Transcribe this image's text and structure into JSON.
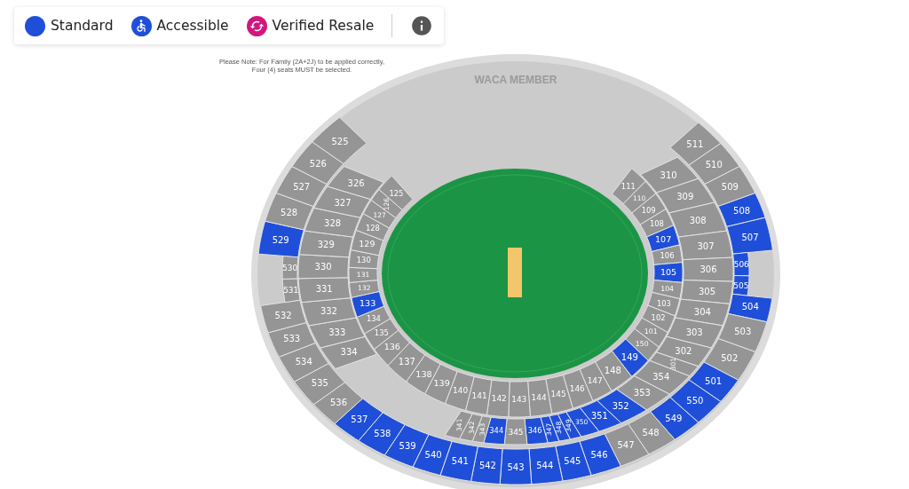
{
  "legend": {
    "items": [
      {
        "kind": "standard",
        "label": "Standard",
        "color": "#1f4fd8"
      },
      {
        "kind": "accessible",
        "label": "Accessible",
        "color": "#1f4fd8"
      },
      {
        "kind": "resale",
        "label": "Verified Resale",
        "color": "#d1167e"
      }
    ]
  },
  "notice": {
    "lines": [
      "Please Note: For Family (2A+2J) to be applied correctly,",
      "Four (4) seats MUST be selected."
    ]
  },
  "map": {
    "area_label": "WACA MEMBER",
    "tiers": [
      {
        "left": [
          {
            "label": "125",
            "available": false
          },
          {
            "label": "126",
            "available": false
          },
          {
            "label": "127",
            "available": false
          },
          {
            "label": "128",
            "available": false
          },
          {
            "label": "129",
            "available": false
          },
          {
            "label": "130",
            "available": false
          },
          {
            "label": "131",
            "available": false
          },
          {
            "label": "132",
            "available": false
          },
          {
            "label": "133",
            "available": true
          },
          {
            "label": "134",
            "available": false
          },
          {
            "label": "135",
            "available": false
          },
          {
            "label": "136",
            "available": false
          }
        ],
        "bottom": [
          {
            "label": "137",
            "available": false
          },
          {
            "label": "138",
            "available": false
          },
          {
            "label": "139",
            "available": false
          },
          {
            "label": "140",
            "available": false
          },
          {
            "label": "141",
            "available": false
          },
          {
            "label": "142",
            "available": false
          },
          {
            "label": "143",
            "available": false
          },
          {
            "label": "144",
            "available": false
          },
          {
            "label": "145",
            "available": false
          },
          {
            "label": "146",
            "available": false
          },
          {
            "label": "147",
            "available": false
          },
          {
            "label": "148",
            "available": false
          }
        ],
        "right": [
          {
            "label": "111",
            "available": false
          },
          {
            "label": "110",
            "available": false
          },
          {
            "label": "109",
            "available": false
          },
          {
            "label": "108",
            "available": false
          },
          {
            "label": "107",
            "available": true
          },
          {
            "label": "106",
            "available": false
          },
          {
            "label": "105",
            "available": true
          },
          {
            "label": "104",
            "available": false
          },
          {
            "label": "103",
            "available": false
          },
          {
            "label": "102",
            "available": false
          },
          {
            "label": "101",
            "available": false
          },
          {
            "label": "150",
            "available": false
          },
          {
            "label": "149",
            "available": true
          }
        ]
      },
      {
        "left": [
          {
            "label": "326",
            "available": false
          },
          {
            "label": "327",
            "available": false
          },
          {
            "label": "328",
            "available": false
          },
          {
            "label": "329",
            "available": false
          },
          {
            "label": "330",
            "available": false
          },
          {
            "label": "331",
            "available": false
          },
          {
            "label": "332",
            "available": false
          },
          {
            "label": "333",
            "available": false
          },
          {
            "label": "334",
            "available": false
          }
        ],
        "bottom": [
          {
            "label": "341",
            "available": false
          },
          {
            "label": "342",
            "available": false
          },
          {
            "label": "343",
            "available": false
          },
          {
            "label": "344",
            "available": true
          },
          {
            "label": "345",
            "available": false
          },
          {
            "label": "346",
            "available": true
          },
          {
            "label": "347",
            "available": true
          },
          {
            "label": "348",
            "available": true
          },
          {
            "label": "349",
            "available": true
          },
          {
            "label": "350",
            "available": true
          },
          {
            "label": "351",
            "available": true
          },
          {
            "label": "352",
            "available": true
          }
        ],
        "right": [
          {
            "label": "310",
            "available": false
          },
          {
            "label": "309",
            "available": false
          },
          {
            "label": "308",
            "available": false
          },
          {
            "label": "307",
            "available": false
          },
          {
            "label": "306",
            "available": false
          },
          {
            "label": "305",
            "available": false
          },
          {
            "label": "304",
            "available": false
          },
          {
            "label": "303",
            "available": false
          },
          {
            "label": "302",
            "available": false
          },
          {
            "label": "301",
            "available": false
          },
          {
            "label": "354",
            "available": false
          },
          {
            "label": "353",
            "available": false
          }
        ]
      },
      {
        "left": [
          {
            "label": "525",
            "available": false
          },
          {
            "label": "526",
            "available": false
          },
          {
            "label": "527",
            "available": false
          },
          {
            "label": "528",
            "available": false
          },
          {
            "label": "529",
            "available": true
          },
          {
            "label": "530",
            "available": false
          },
          {
            "label": "531",
            "available": false
          },
          {
            "label": "532",
            "available": false
          },
          {
            "label": "533",
            "available": false
          },
          {
            "label": "534",
            "available": false
          },
          {
            "label": "535",
            "available": false
          },
          {
            "label": "536",
            "available": false
          }
        ],
        "bottom": [
          {
            "label": "537",
            "available": true
          },
          {
            "label": "538",
            "available": true
          },
          {
            "label": "539",
            "available": true
          },
          {
            "label": "540",
            "available": true
          },
          {
            "label": "541",
            "available": true
          },
          {
            "label": "542",
            "available": true
          },
          {
            "label": "543",
            "available": true
          },
          {
            "label": "544",
            "available": true
          },
          {
            "label": "545",
            "available": true
          },
          {
            "label": "546",
            "available": true
          },
          {
            "label": "547",
            "available": false
          },
          {
            "label": "548",
            "available": false
          },
          {
            "label": "549",
            "available": true
          }
        ],
        "right": [
          {
            "label": "511",
            "available": false
          },
          {
            "label": "510",
            "available": false
          },
          {
            "label": "509",
            "available": false
          },
          {
            "label": "508",
            "available": true
          },
          {
            "label": "507",
            "available": true
          },
          {
            "label": "506",
            "available": true
          },
          {
            "label": "505",
            "available": true
          },
          {
            "label": "504",
            "available": true
          },
          {
            "label": "503",
            "available": false
          },
          {
            "label": "502",
            "available": false
          },
          {
            "label": "501",
            "available": true
          },
          {
            "label": "550",
            "available": true
          }
        ]
      }
    ]
  }
}
